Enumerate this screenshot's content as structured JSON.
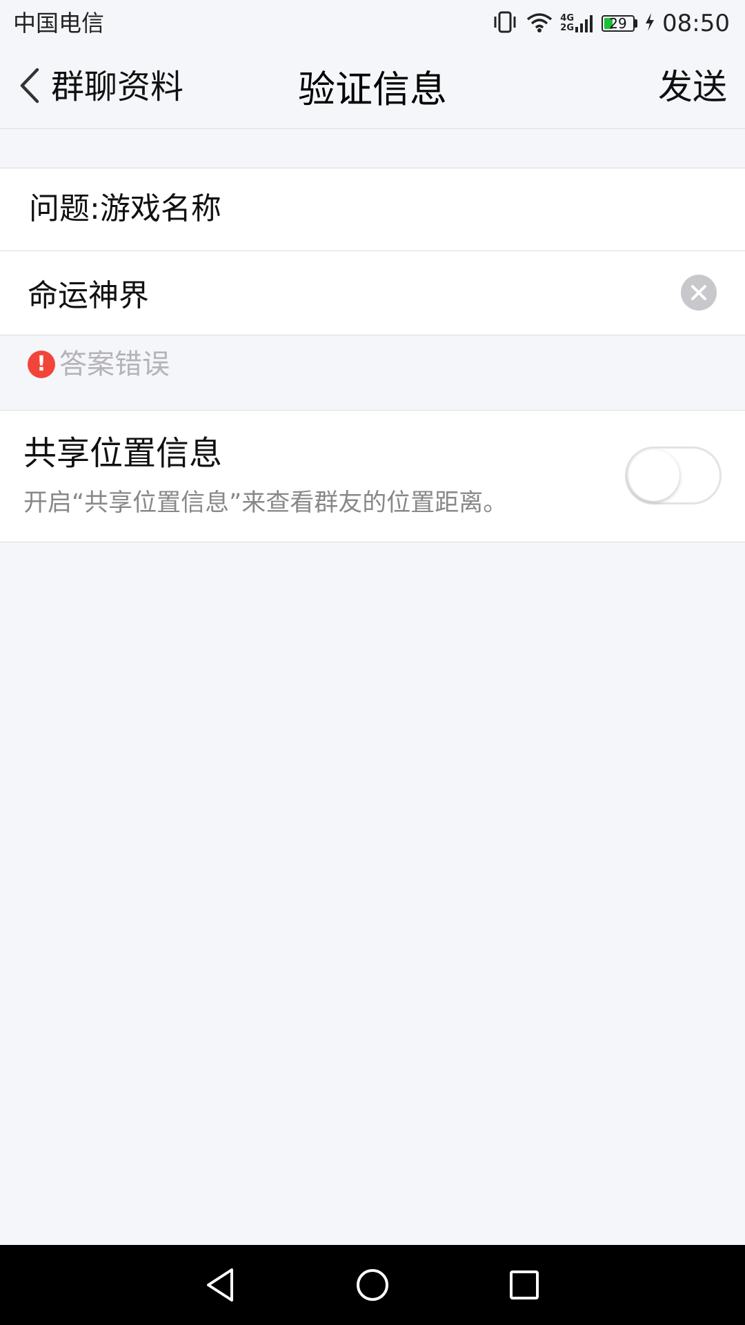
{
  "status_bar": {
    "carrier": "中国电信",
    "battery_level": "29",
    "battery_fraction": 0.29,
    "time": "08:50",
    "network_label_top": "4G",
    "network_label_bottom": "2G"
  },
  "nav": {
    "back_label": "群聊资料",
    "title": "验证信息",
    "send_label": "发送"
  },
  "question": {
    "text": "问题:游戏名称"
  },
  "answer": {
    "value": "命运神界",
    "placeholder": ""
  },
  "error": {
    "icon": "!",
    "text": "答案错误"
  },
  "location": {
    "title": "共享位置信息",
    "description": "开启“共享位置信息”来查看群友的位置距离。",
    "enabled": false
  },
  "colors": {
    "background": "#f5f6f9",
    "error": "#f1453a",
    "battery": "#1fbf3a"
  }
}
